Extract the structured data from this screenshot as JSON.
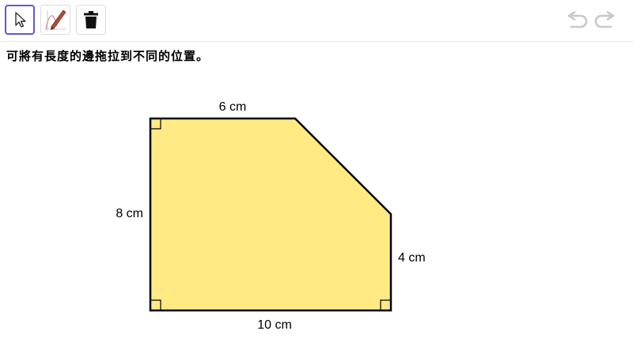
{
  "toolbar": {
    "tools": [
      {
        "name": "move",
        "icon": "cursor-arrow-icon",
        "selected": true
      },
      {
        "name": "pen",
        "icon": "pen-icon",
        "selected": false
      },
      {
        "name": "delete",
        "icon": "trash-icon",
        "selected": false
      }
    ],
    "history": [
      {
        "name": "undo",
        "icon": "undo-icon"
      },
      {
        "name": "redo",
        "icon": "redo-icon"
      }
    ]
  },
  "instruction": "可將有長度的邊拖拉到不同的位置。",
  "shape": {
    "fill_color": "#ffea84",
    "stroke_color": "#000000",
    "labels": {
      "top": "6 cm",
      "left": "8 cm",
      "right": "4 cm",
      "bottom": "10 cm"
    }
  },
  "colors": {
    "accent": "#6557d2",
    "icon_gray": "#c8c8c8"
  }
}
